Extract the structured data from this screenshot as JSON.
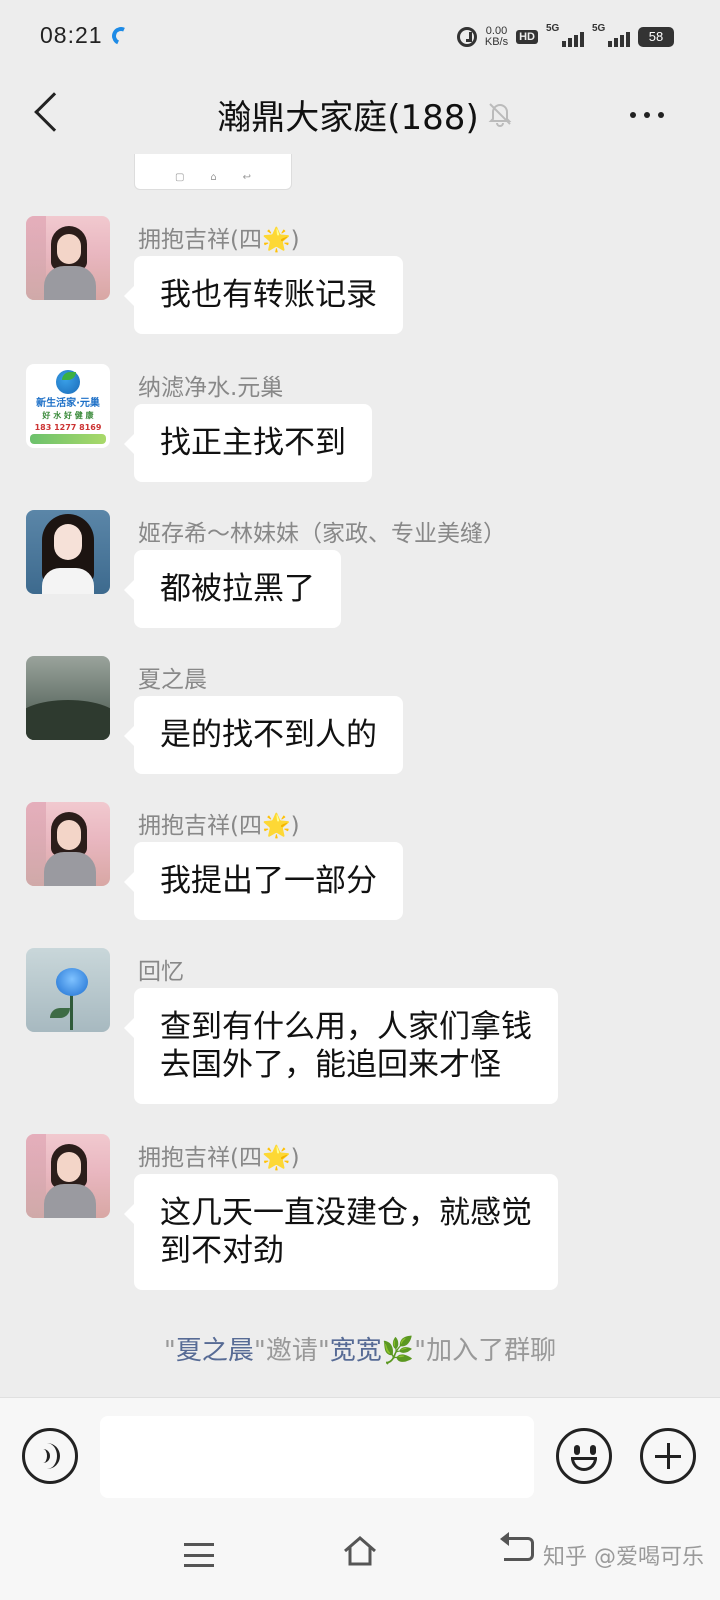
{
  "status_bar": {
    "time": "08:21",
    "net_speed_value": "0.00",
    "net_speed_unit": "KB/s",
    "hd_label": "HD",
    "sim1_label": "5G",
    "sim2_label": "5G",
    "battery": "58"
  },
  "header": {
    "title": "瀚鼎大家庭(188)"
  },
  "messages": [
    {
      "sender": "拥抱吉祥(四🌟)",
      "text": "我也有转账记录",
      "avatar_icon": "woman-avatar"
    },
    {
      "sender": "纳滤净水.元巢",
      "text": "找正主找不到",
      "avatar_icon": "water-logo-avatar",
      "avatar_text": [
        "新生活家·元巢",
        "好 水 好 健 康",
        "183 1277 8169"
      ]
    },
    {
      "sender": "姬存希～林妹妹（家政、专业美缝）",
      "text": "都被拉黑了",
      "avatar_icon": "woman-avatar"
    },
    {
      "sender": "夏之晨",
      "text": "是的找不到人的",
      "avatar_icon": "misty-landscape-avatar"
    },
    {
      "sender": "拥抱吉祥(四🌟)",
      "text": "我提出了一部分",
      "avatar_icon": "woman-avatar"
    },
    {
      "sender": "回忆",
      "text_lines": [
        "查到有什么用，人家们拿钱",
        "去国外了，能追回来才怪"
      ],
      "avatar_icon": "blue-rose-avatar"
    },
    {
      "sender": "拥抱吉祥(四🌟)",
      "text_lines": [
        "这几天一直没建仓，就感觉",
        "到不对劲"
      ],
      "avatar_icon": "woman-avatar"
    }
  ],
  "system_message": {
    "q1": "\"",
    "inviter": "夏之晨",
    "mid": "\"邀请\"",
    "invitee": "宽宽🌿",
    "end": "\"加入了群聊"
  },
  "watermark": "知乎 @爱喝可乐",
  "colors": {
    "background": "#ededed",
    "bubble": "#ffffff",
    "link_name": "#576b95",
    "sender_name": "#888888"
  }
}
